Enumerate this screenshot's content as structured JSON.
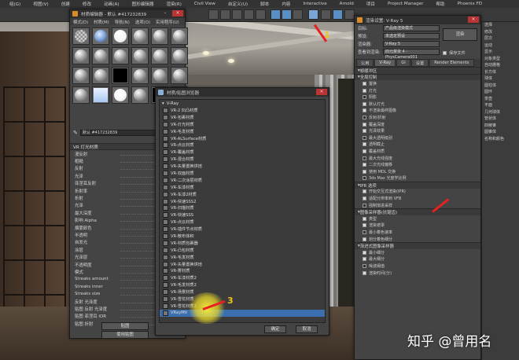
{
  "menubar": [
    "组(G)",
    "视图(V)",
    "创建",
    "修改",
    "动画(A)",
    "图形编辑器",
    "渲染(R)",
    "Civil View",
    "自定义(U)",
    "脚本",
    "内容",
    "Interactive",
    "Arnold",
    "项目",
    "Project Manager",
    "帮助",
    "Phoenix FD"
  ],
  "material_editor": {
    "title": "材质编辑器 - 默认 #417232839",
    "menu": [
      "模式(D)",
      "材质(M)",
      "导航(N)",
      "选项(O)",
      "实用程序(U)"
    ],
    "spheres": [
      "checker",
      "colorful",
      "white",
      "grey",
      "grey",
      "grey",
      "grey",
      "grey",
      "grey",
      "grey",
      "grey",
      "grey",
      "grey",
      "grey",
      "black",
      "grey",
      "grey",
      "grey",
      "grey",
      "blueish",
      "white",
      "grey",
      "black",
      "grey"
    ],
    "current_material": "默认 #417232839",
    "params_header": "VR 灯光材质",
    "params": [
      {
        "label": "漫反射",
        "value": ""
      },
      {
        "label": "粗糙",
        "value": "0.0"
      },
      {
        "label": "反射",
        "value": ""
      },
      {
        "label": "光泽",
        "value": "1.0"
      },
      {
        "label": "菲涅耳反射",
        "value": ""
      },
      {
        "label": "折射率",
        "value": "1.6"
      },
      {
        "label": "折射",
        "value": ""
      },
      {
        "label": "光泽",
        "value": "1.0"
      },
      {
        "label": "最大深度",
        "value": "5"
      },
      {
        "label": "影响 Alpha",
        "value": ""
      },
      {
        "label": "烟雾颜色",
        "value": ""
      },
      {
        "label": "半透明",
        "value": ""
      },
      {
        "label": "自发光",
        "value": ""
      },
      {
        "label": "涂层",
        "value": ""
      },
      {
        "label": "光泽层",
        "value": ""
      },
      {
        "label": "不透明度",
        "value": "1.0"
      },
      {
        "label": "模式",
        "value": "只影响阴影(AO)"
      },
      {
        "label": "Streaks amount",
        "value": "0.0"
      },
      {
        "label": "Streaks inner",
        "value": "0.0"
      },
      {
        "label": "Streaks size",
        "value": "0.0"
      },
      {
        "label": "反射 光泽度",
        "value": "100.0"
      },
      {
        "label": "贴图 反射 光泽度",
        "value": "100.0"
      },
      {
        "label": "贴图 菲涅耳 IOR",
        "value": "100.0"
      },
      {
        "label": "贴图 折射",
        "value": "100.0"
      }
    ],
    "bottom_buttons": [
      "贴图",
      "使用贴图"
    ]
  },
  "material_browser": {
    "title": "材质/贴图浏览器",
    "category": "V-Ray",
    "items": [
      "VR-2 凹凸材质",
      "VR-包裹材质",
      "VR-灯光材质",
      "VR-毛发材质",
      "VR-ALSurface材质",
      "VR-点云材质",
      "VR-覆盖材质",
      "VR-混合材质",
      "VR-矢量置换烘焙",
      "VR-双面材质",
      "VR-二次涂层材质",
      "VR-车漆材质",
      "VR-车漆2材质",
      "VR-快速SSS2",
      "VR-扫描材质",
      "VR-快速SSS",
      "VR-点云材质",
      "VR-插件节点材质",
      "VR-散布体积",
      "VR-材质包裹器",
      "VR-凸包材质",
      "VR-毛发材质",
      "VR-矢量置换烘焙",
      "VR-雾材质",
      "VR-车漆材质2",
      "VR-毛发材质2",
      "VR-场景材质",
      "VR-雪花材质",
      "VR-雪花材质2",
      "VRayMtl"
    ],
    "selected_index": 29,
    "buttons": [
      "确定",
      "取消"
    ]
  },
  "render_setup": {
    "title": "渲染设置: V-Ray 5",
    "rows": [
      {
        "label": "目标:",
        "value": "产品级渲染模式"
      },
      {
        "label": "预设:",
        "value": "未选定预设"
      },
      {
        "label": "渲染器:",
        "value": "V-Ray 5"
      },
      {
        "label": "查看到渲染:",
        "value": "四元菜单 4 - PhysCamera001"
      }
    ],
    "render_button": "渲染",
    "save_file": "保存文件",
    "tabs": [
      "公用",
      "V-Ray",
      "GI",
      "设置",
      "Render Elements"
    ],
    "sections": [
      {
        "title": "帧缓冲区",
        "lines": []
      },
      {
        "title": "全局控制",
        "lines": [
          "置换",
          "灯光",
          "阴影",
          "默认灯光",
          "不渲染最终图像",
          "反射/折射",
          "覆盖深度",
          "光泽效果",
          "最大透明级别",
          "透明截止",
          "覆盖材质",
          "最大光线强度",
          "二次光线偏移",
          "使用 MDL 交换",
          "3ds Max 光度学比例"
        ]
      },
      {
        "title": "IPR 选项",
        "lines": [
          "开始交互式渲染(IPR)",
          "适配分辨率到 VFB",
          "强制渐进采样"
        ]
      },
      {
        "title": "图像采样器(抗锯齿)",
        "lines": [
          "类型",
          "渲染遮罩",
          "最小着色速率",
          "划分着色细分"
        ]
      },
      {
        "title": "渐进式图像采样器",
        "lines": [
          "最小细分",
          "最大细分",
          "噪波阈值",
          "渲染时间(分)"
        ]
      }
    ],
    "values": {
      "min_rate": "6",
      "min_subdiv": "1",
      "max_subdiv": "100",
      "noise": "0.005",
      "max_transp": "50",
      "cutoff": "0.001",
      "intensity": "20.0",
      "bias": "0.0"
    }
  },
  "command_panel": [
    "选择",
    "修改",
    "层次",
    "运动",
    "显示",
    "对象类型",
    "自动栅格",
    "长方体",
    "球体",
    "圆柱体",
    "圆环",
    "茶壶",
    "平面",
    "几何球体",
    "管状体",
    "四棱锥",
    "圆锥体",
    "名称和颜色"
  ],
  "annotations": [
    "1",
    "2",
    "3"
  ],
  "watermark": "知乎 @曾用名"
}
